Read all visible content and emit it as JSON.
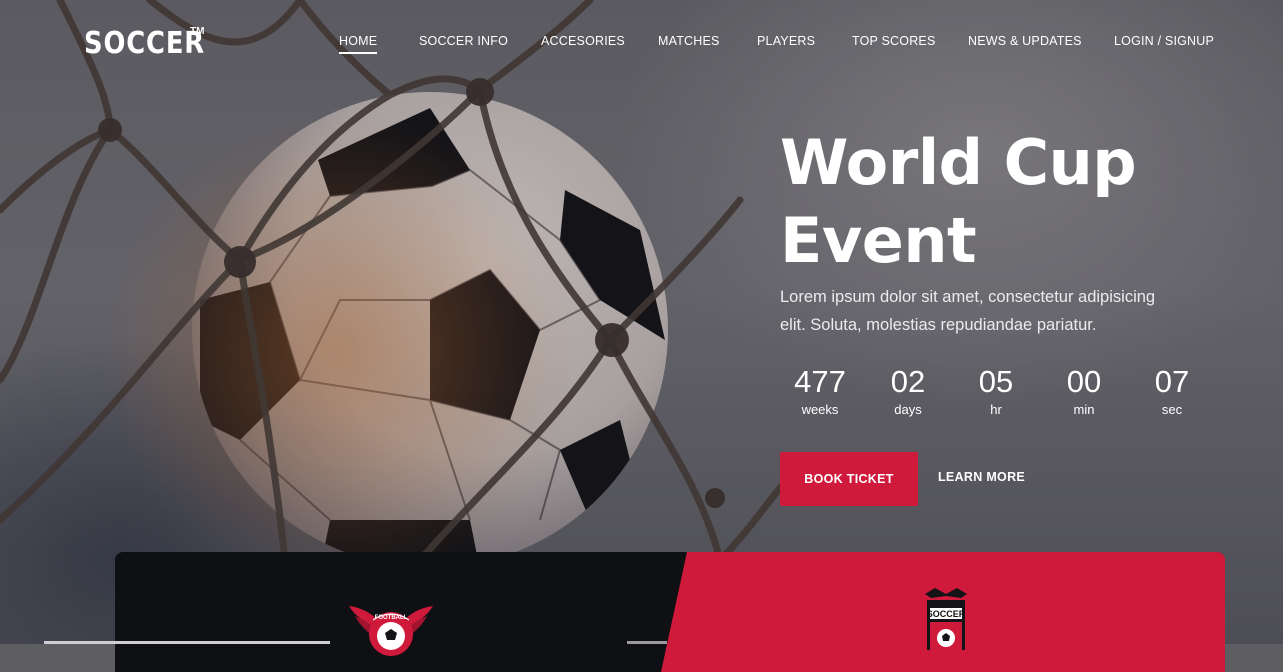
{
  "brand": {
    "name": "SOCCER",
    "trademark": "TM"
  },
  "nav": {
    "items": [
      {
        "label": "HOME",
        "active": true
      },
      {
        "label": "SOCCER INFO",
        "active": false
      },
      {
        "label": "ACCESORIES",
        "active": false
      },
      {
        "label": "MATCHES",
        "active": false
      },
      {
        "label": "PLAYERS",
        "active": false
      },
      {
        "label": "TOP SCORES",
        "active": false
      },
      {
        "label": "NEWS & UPDATES",
        "active": false
      },
      {
        "label": "LOGIN / SIGNUP",
        "active": false
      }
    ]
  },
  "hero": {
    "title_line1": "World Cup",
    "title_line2": "Event",
    "description_line1": "Lorem ipsum dolor sit amet, consectetur adipisicing",
    "description_line2": "elit. Soluta, molestias repudiandae pariatur.",
    "countdown": [
      {
        "value": "477",
        "unit": "weeks"
      },
      {
        "value": "02",
        "unit": "days"
      },
      {
        "value": "05",
        "unit": "hr"
      },
      {
        "value": "00",
        "unit": "min"
      },
      {
        "value": "07",
        "unit": "sec"
      }
    ],
    "primary_button": "BOOK TICKET",
    "secondary_link": "LEARN MORE"
  },
  "match_panel": {
    "home_team_badge_text": "FOOTBALL",
    "away_team_badge_text": "SOCCER"
  },
  "colors": {
    "accent": "#cf1a3b",
    "panel_dark": "#0f1014",
    "text": "#ffffff"
  },
  "icons": {
    "hero_image": "soccer-ball-in-net",
    "home_badge": "winged-football-emblem",
    "away_badge": "soccer-shield-emblem"
  }
}
